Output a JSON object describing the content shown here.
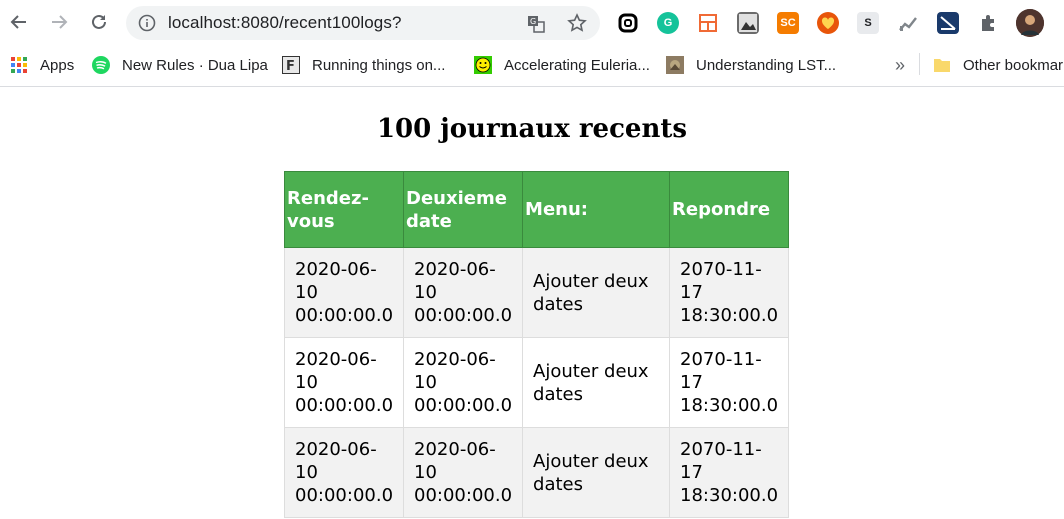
{
  "browser": {
    "url": "localhost:8080/recent100logs?",
    "bookmarks": [
      {
        "label": "Apps",
        "icon": "apps-grid-icon"
      },
      {
        "label": "New Rules · Dua Lipa",
        "icon": "spotify-icon"
      },
      {
        "label": "Running things on...",
        "icon": "f-site-icon"
      },
      {
        "label": "Accelerating Euleria...",
        "icon": "smiley-icon"
      },
      {
        "label": "Understanding LST...",
        "icon": "thumbnail-icon"
      }
    ],
    "overflow_label": "»",
    "other_bookmarks": "Other bookmar",
    "extensions": [
      "SC",
      "S"
    ]
  },
  "page": {
    "title": "100 journaux recents",
    "headers": [
      "Rendez-vous",
      "Deuxieme date",
      "Menu:",
      "Repondre"
    ],
    "rows": [
      [
        "2020-06-10 00:00:00.0",
        "2020-06-10 00:00:00.0",
        "Ajouter deux dates",
        "2070-11-17 18:30:00.0"
      ],
      [
        "2020-06-10 00:00:00.0",
        "2020-06-10 00:00:00.0",
        "Ajouter deux dates",
        "2070-11-17 18:30:00.0"
      ],
      [
        "2020-06-10 00:00:00.0",
        "2020-06-10 00:00:00.0",
        "Ajouter deux dates",
        "2070-11-17 18:30:00.0"
      ]
    ]
  },
  "colors": {
    "header_bg": "#4caf50",
    "odd_row_bg": "#f2f2f2"
  }
}
